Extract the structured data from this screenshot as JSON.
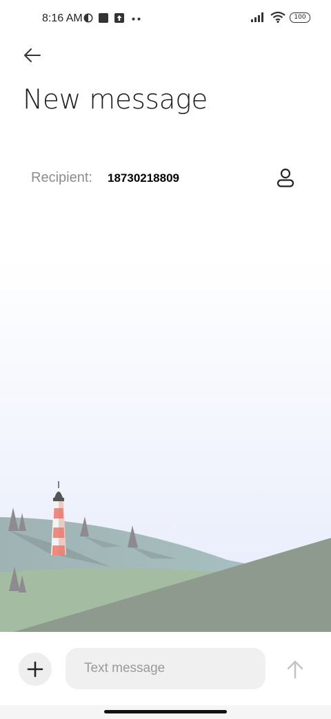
{
  "status_bar": {
    "time": "8:16 AM",
    "left_icons": [
      "circle-half-icon",
      "square-icon",
      "upload-icon",
      "more-dots-icon"
    ],
    "right_icons": [
      "signal-icon",
      "wifi-icon"
    ],
    "battery": "100"
  },
  "header": {
    "back_icon": "back-arrow-icon",
    "title": "New message"
  },
  "recipient": {
    "label": "Recipient:",
    "value": "18730218809",
    "contact_icon": "contact-person-icon"
  },
  "composer": {
    "add_icon": "plus-icon",
    "placeholder": "Text message",
    "value": "",
    "send_icon": "send-arrow-icon"
  },
  "colors": {
    "background": "#ffffff",
    "sky_bottom": "#eaeefc",
    "hill_front": "#8e9b8f",
    "hill_back": "#a4b6b6",
    "lighthouse_red": "#f08a7e",
    "input_bg": "#f0f0f0"
  }
}
